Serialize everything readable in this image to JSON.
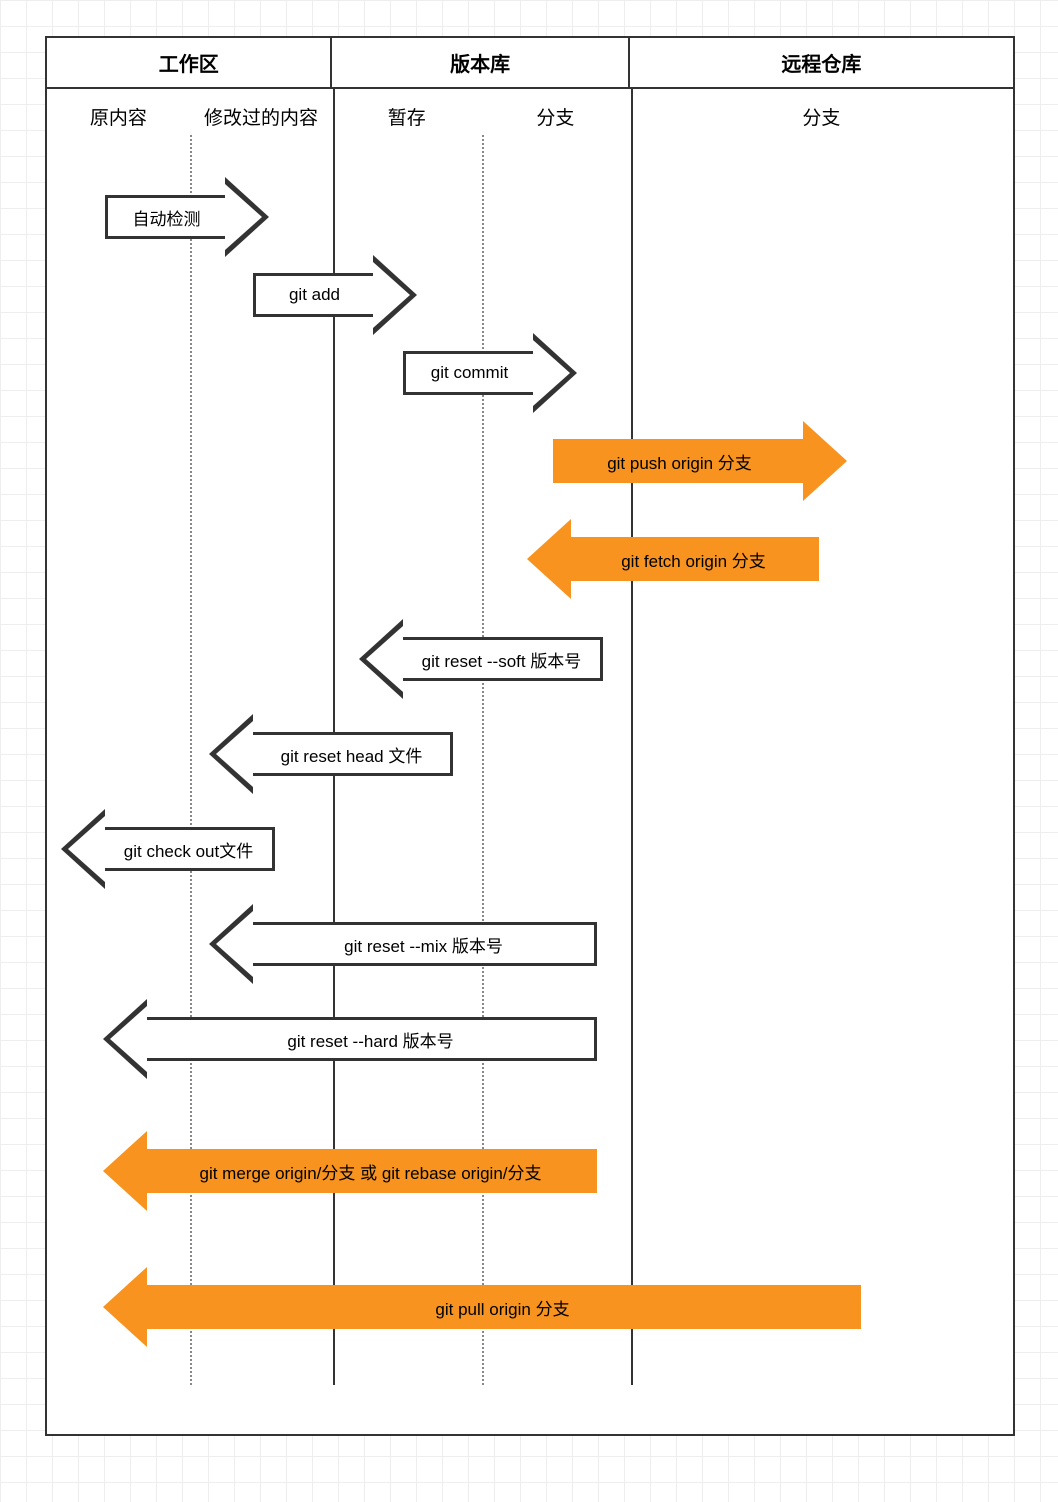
{
  "headers": {
    "working_area": "工作区",
    "repository": "版本库",
    "remote": "远程仓库"
  },
  "subheaders": {
    "original": "原内容",
    "modified": "修改过的内容",
    "staged": "暂存",
    "branch_local": "分支",
    "branch_remote": "分支"
  },
  "arrows": {
    "auto_detect": "自动检测",
    "git_add": "git add",
    "git_commit": "git commit",
    "git_push": "git push origin 分支",
    "git_fetch": "git fetch origin  分支",
    "reset_soft": "git reset --soft 版本号",
    "reset_head": "git reset head 文件",
    "checkout": "git check out文件",
    "reset_mix": "git reset --mix 版本号",
    "reset_hard": "git reset --hard 版本号",
    "merge_rebase": "git merge origin/分支 或 git rebase origin/分支",
    "git_pull": "git pull origin  分支"
  }
}
